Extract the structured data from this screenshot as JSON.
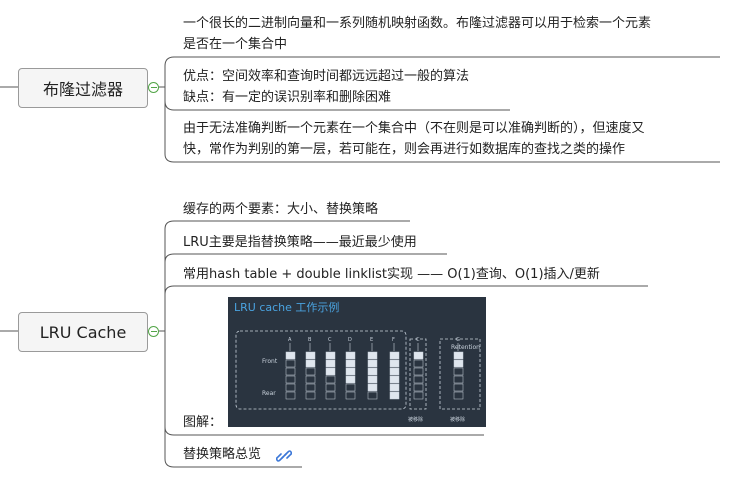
{
  "topics": [
    {
      "title": "布隆过滤器",
      "children": [
        {
          "lines": [
            "一个很长的二进制向量和一系列随机映射函数。布隆过滤器可以用于检索一个元素",
            "是否在一个集合中"
          ]
        },
        {
          "lines": [
            "优点：空间效率和查询时间都远远超过一般的算法",
            "缺点：有一定的误识别率和删除困难"
          ]
        },
        {
          "lines": [
            "由于无法准确判断一个元素在一个集合中（不在则是可以准确判断的），但速度又",
            "快，常作为判别的第一层，若可能在，则会再进行如数据库的查找之类的操作"
          ]
        }
      ]
    },
    {
      "title": "LRU Cache",
      "children": [
        {
          "lines": [
            "缓存的两个要素：大小、替换策略"
          ]
        },
        {
          "lines": [
            "LRU主要是指替换策略——最近最少使用"
          ]
        },
        {
          "lines": [
            "常用hash table + double linklist实现 —— O(1)查询、O(1)插入/更新"
          ]
        },
        {
          "lines": [
            "图解："
          ]
        },
        {
          "lines": [
            "替换策略总览"
          ]
        }
      ]
    }
  ],
  "diagram_image": {
    "title": "LRU cache 工作示例",
    "col_labels": [
      "A",
      "B",
      "C",
      "D",
      "E",
      "F",
      "C",
      "G"
    ],
    "front_label": "Front",
    "rear_label": "Rear",
    "retention_label": "Retention",
    "evicted_label": "被移除",
    "evicted_label_2": "被移除"
  },
  "icons": {
    "link": "link-icon",
    "collapse": "collapse-minus-icon"
  },
  "colors": {
    "collapse": "#53a548",
    "link": "#3c78d8",
    "image_bg": "#2a3440",
    "image_title": "#4aa3e0"
  }
}
